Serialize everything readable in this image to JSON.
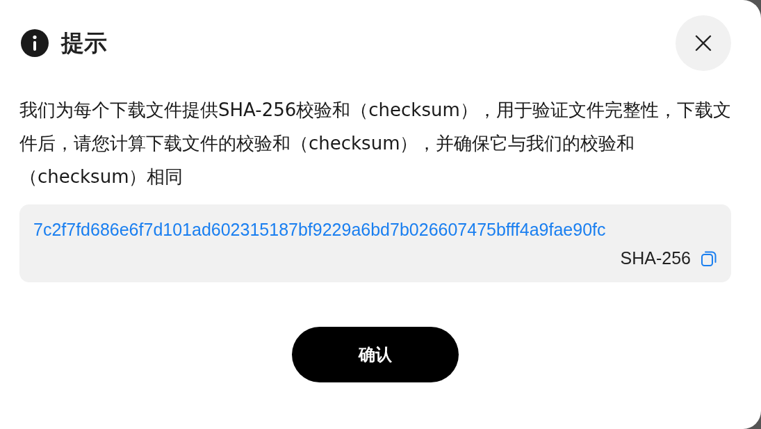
{
  "dialog": {
    "title": "提示",
    "message": "我们为每个下载文件提供SHA-256校验和（checksum），用于验证文件完整性，下载文件后，请您计算下载文件的校验和（checksum），并确保它与我们的校验和（checksum）相同",
    "checksum": {
      "value": "7c2f7fd686e6f7d101ad602315187bf9229a6bd7b026607475bfff4a9fae90fc",
      "algorithm": "SHA-256"
    },
    "buttons": [
      "确认"
    ]
  }
}
